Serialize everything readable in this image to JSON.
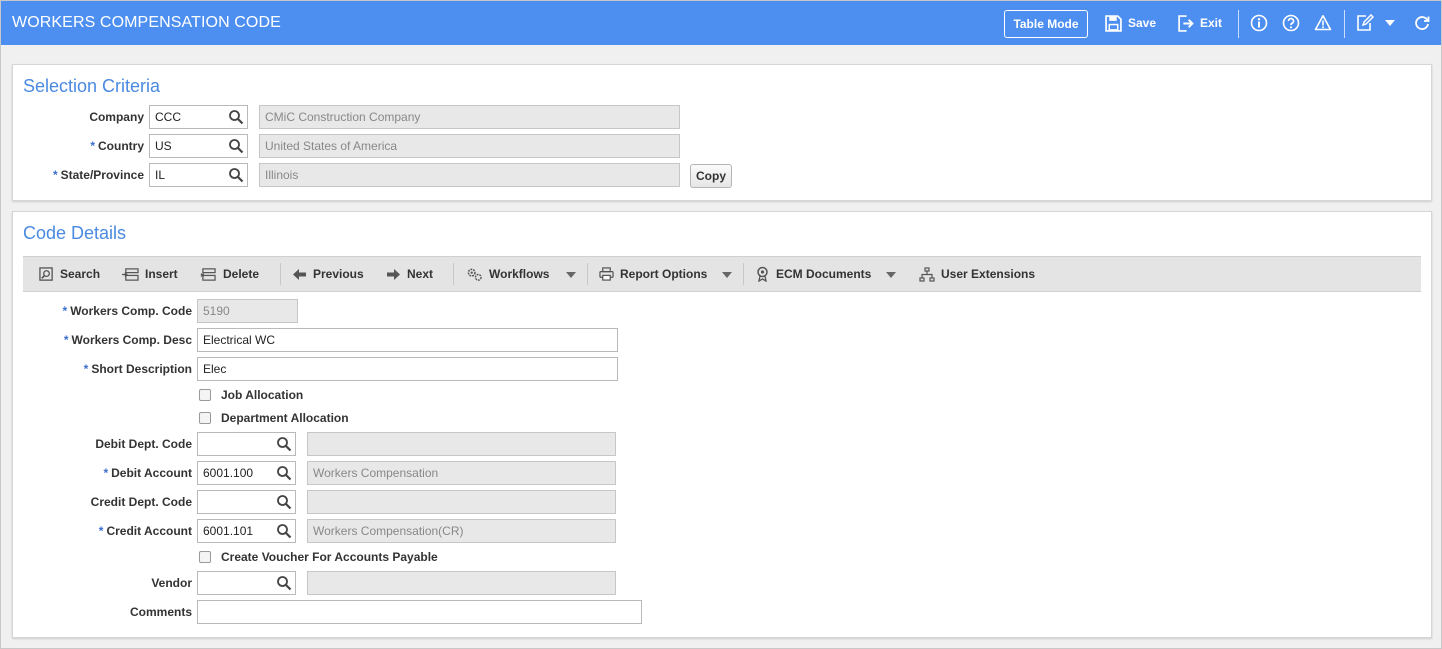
{
  "header": {
    "title": "WORKERS COMPENSATION CODE",
    "table_mode": "Table Mode",
    "save": "Save",
    "exit": "Exit",
    "icons": [
      "info-icon",
      "help-icon",
      "warning-icon",
      "edit-icon",
      "refresh-icon"
    ]
  },
  "selection": {
    "title": "Selection Criteria",
    "company": {
      "label": "Company",
      "value": "CCC",
      "desc": "CMiC Construction Company"
    },
    "country": {
      "label": "Country",
      "value": "US",
      "desc": "United States of America"
    },
    "state": {
      "label": "State/Province",
      "value": "IL",
      "desc": "Illinois"
    },
    "copy": "Copy"
  },
  "details": {
    "title": "Code Details",
    "toolbar": {
      "search": "Search",
      "insert": "Insert",
      "delete": "Delete",
      "previous": "Previous",
      "next": "Next",
      "workflows": "Workflows",
      "report_options": "Report Options",
      "ecm_documents": "ECM Documents",
      "user_extensions": "User Extensions"
    },
    "wc_code": {
      "label": "Workers Comp. Code",
      "value": "5190"
    },
    "wc_desc": {
      "label": "Workers Comp. Desc",
      "value": "Electrical WC"
    },
    "short_desc": {
      "label": "Short Description",
      "value": "Elec"
    },
    "job_allocation": "Job Allocation",
    "dept_allocation": "Department Allocation",
    "debit_dept": {
      "label": "Debit Dept. Code",
      "value": "",
      "desc": ""
    },
    "debit_account": {
      "label": "Debit Account",
      "value": "6001.100",
      "desc": "Workers Compensation"
    },
    "credit_dept": {
      "label": "Credit Dept. Code",
      "value": "",
      "desc": ""
    },
    "credit_account": {
      "label": "Credit Account",
      "value": "6001.101",
      "desc": "Workers Compensation(CR)"
    },
    "create_voucher": "Create Voucher For Accounts Payable",
    "vendor": {
      "label": "Vendor",
      "value": "",
      "desc": ""
    },
    "comments": {
      "label": "Comments",
      "value": ""
    }
  }
}
